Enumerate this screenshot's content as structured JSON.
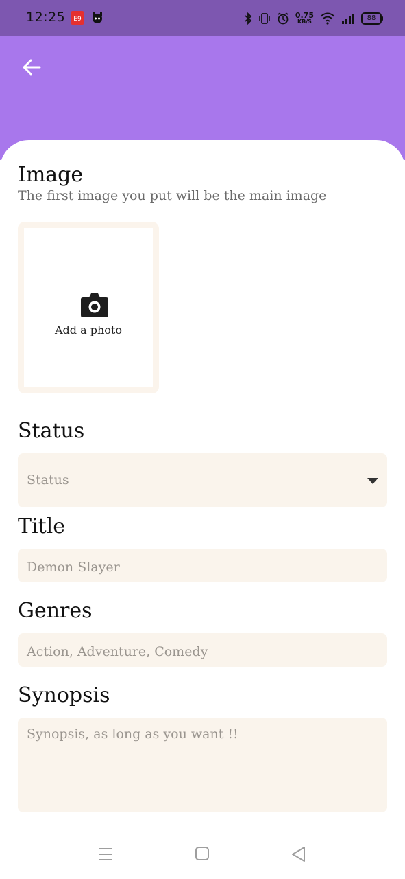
{
  "status_bar": {
    "time": "12:25",
    "net_speed_value": "0.75",
    "net_speed_unit": "KB/S",
    "battery": "88",
    "icons": [
      "app-red-badge-icon",
      "app-mascot-icon",
      "bluetooth-icon",
      "vibrate-icon",
      "alarm-icon",
      "wifi-icon",
      "signal-icon",
      "battery-icon"
    ]
  },
  "header": {
    "back_icon": "arrow-left-icon",
    "colors": {
      "status_bar": "#7d57b0",
      "header": "#a877ec"
    }
  },
  "image_section": {
    "title": "Image",
    "subtitle": "The first image you put will be the main image",
    "add_photo_label": "Add a photo",
    "icon": "camera-icon"
  },
  "status_section": {
    "title": "Status",
    "placeholder": "Status"
  },
  "title_section": {
    "title": "Title",
    "placeholder": "Demon Slayer"
  },
  "genres_section": {
    "title": "Genres",
    "placeholder": "Action, Adventure, Comedy"
  },
  "synopsis_section": {
    "title": "Synopsis",
    "placeholder": "Synopsis, as long as you want !!"
  },
  "nav_bar": {
    "icons": [
      "menu-icon",
      "home-icon",
      "back-triangle-icon"
    ]
  }
}
